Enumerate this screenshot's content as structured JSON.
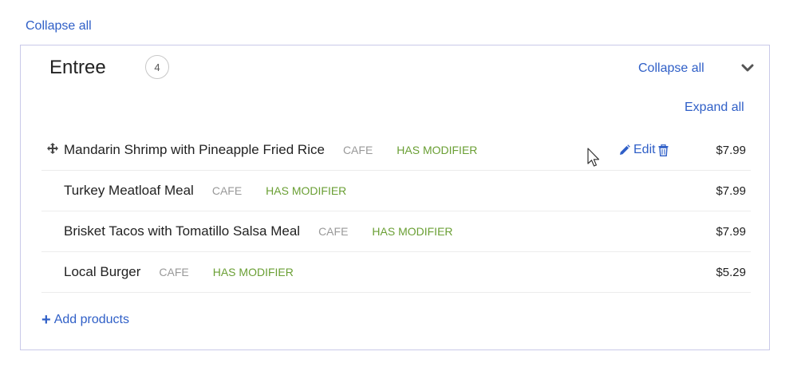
{
  "top": {
    "collapse_all_label": "Collapse all"
  },
  "category": {
    "title": "Entree",
    "count": "4",
    "collapse_all_label": "Collapse all",
    "expand_all_label": "Expand all"
  },
  "products": [
    {
      "name": "Mandarin Shrimp with Pineapple Fried Rice",
      "location": "CAFE",
      "modifier": "HAS MODIFIER",
      "price": "$7.99",
      "edit_label": "Edit"
    },
    {
      "name": "Turkey Meatloaf Meal",
      "location": "CAFE",
      "modifier": "HAS MODIFIER",
      "price": "$7.99"
    },
    {
      "name": "Brisket Tacos with Tomatillo Salsa Meal",
      "location": "CAFE",
      "modifier": "HAS MODIFIER",
      "price": "$7.99"
    },
    {
      "name": "Local Burger",
      "location": "CAFE",
      "modifier": "HAS MODIFIER",
      "price": "$5.29"
    }
  ],
  "footer": {
    "add_products_label": "Add products"
  },
  "colors": {
    "link": "#2f5fc7",
    "modifier": "#6a9f34",
    "muted": "#999999",
    "border": "#c9c9e8"
  },
  "icons": [
    "move-icon",
    "pencil-icon",
    "trash-icon",
    "chevron-down-icon",
    "plus-icon",
    "mouse-cursor-icon"
  ]
}
